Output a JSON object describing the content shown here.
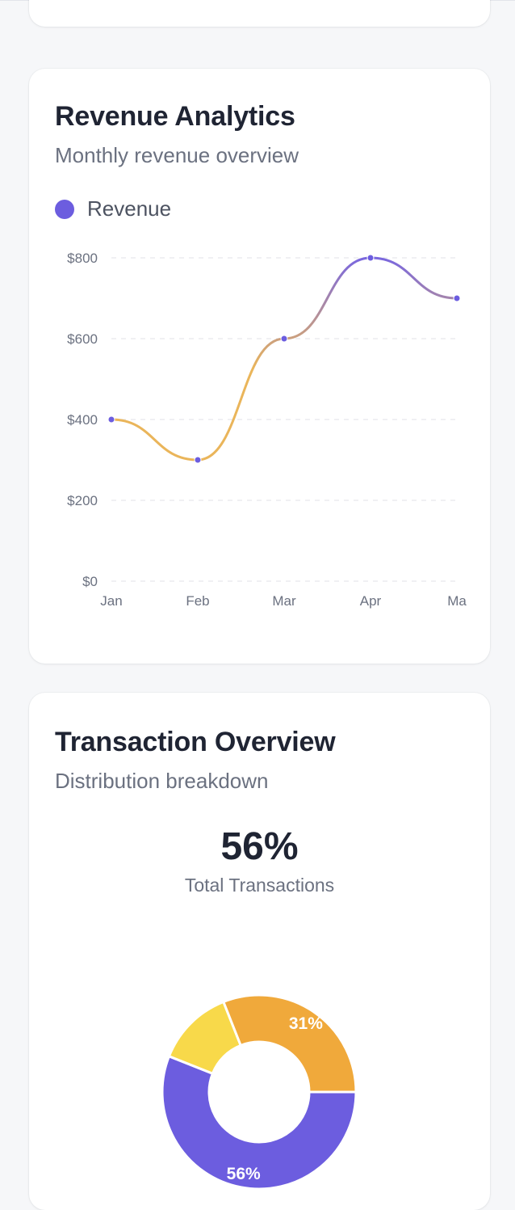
{
  "revenue_card": {
    "title": "Revenue Analytics",
    "subtitle": "Monthly revenue overview",
    "legend_label": "Revenue"
  },
  "transaction_card": {
    "title": "Transaction Overview",
    "subtitle": "Distribution breakdown",
    "total_value": "56%",
    "total_label": "Total Transactions"
  },
  "colors": {
    "accent": "#6c5ddf",
    "orange": "#f0a93b",
    "yellow": "#f8d94a",
    "line_start": "#eab55a",
    "line_end": "#7a67de"
  },
  "chart_data": [
    {
      "type": "line",
      "x": [
        "Jan",
        "Feb",
        "Mar",
        "Apr",
        "Ma"
      ],
      "series": [
        {
          "name": "Revenue",
          "values": [
            400,
            300,
            600,
            800,
            700
          ]
        }
      ],
      "yticks": [
        "$0",
        "$200",
        "$400",
        "$600",
        "$800"
      ],
      "ylim": [
        0,
        800
      ],
      "grid": true,
      "legend": "top-left"
    },
    {
      "type": "pie",
      "variant": "donut",
      "slices": [
        {
          "label": "56%",
          "value": 56,
          "color": "#6c5ddf"
        },
        {
          "label": "13%",
          "value": 13,
          "color": "#f8d94a"
        },
        {
          "label": "31%",
          "value": 31,
          "color": "#f0a93b"
        }
      ]
    }
  ]
}
